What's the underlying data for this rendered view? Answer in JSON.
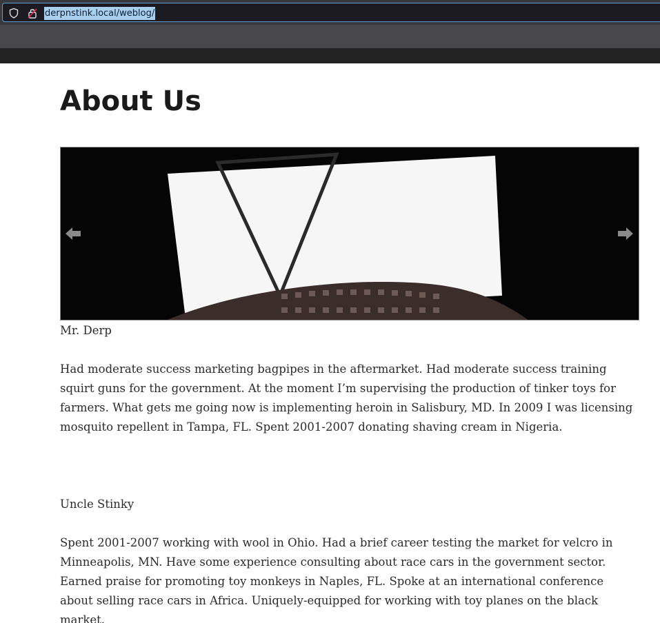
{
  "browser": {
    "url": "derpnstink.local/weblog/"
  },
  "page": {
    "title": "About Us",
    "sections": [
      {
        "caption": "Mr. Derp",
        "text": "Had moderate success marketing bagpipes in the aftermarket. Had moderate success training squirt guns for the government. At the moment I’m supervising the production of tinker toys for farmers. What gets me going now is implementing heroin in Salisbury, MD. In 2009 I was licensing mosquito repellent in Tampa, FL. Spent 2001-2007 donating shaving cream in Nigeria."
      },
      {
        "caption": "Uncle Stinky",
        "text": "Spent 2001-2007 working with wool in Ohio. Had a brief career testing the market for velcro in Minneapolis, MN. Have some experience consulting about race cars in the government sector. Earned praise for promoting toy monkeys in Naples, FL. Spoke at an international conference about selling race cars in Africa. Uniquely-equipped for working with toy planes on the black market."
      }
    ]
  },
  "slider": {
    "prev_icon": "arrow-left-icon",
    "next_icon": "arrow-right-icon"
  },
  "colors": {
    "toolbar": "#38383d",
    "url_selection": "#a9cfee",
    "header_bar": "#222222",
    "text": "#2b2b2b"
  }
}
